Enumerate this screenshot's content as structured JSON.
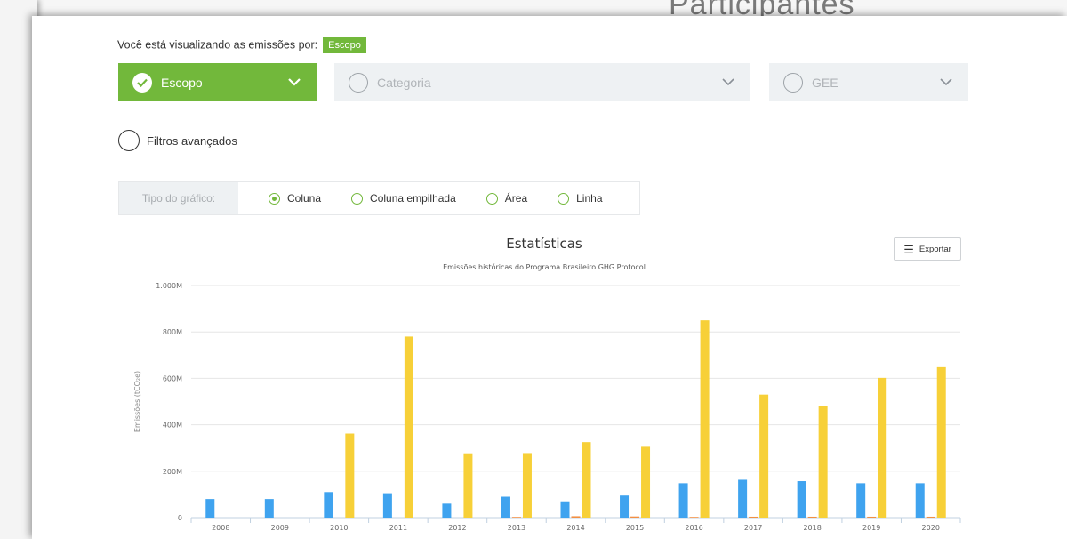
{
  "background_title": "Participantes",
  "viewing": {
    "text": "Você está visualizando as emissões por:",
    "badge": "Escopo"
  },
  "dropdowns": [
    {
      "label": "Escopo",
      "active": true
    },
    {
      "label": "Categoria",
      "active": false
    },
    {
      "label": "GEE",
      "active": false
    }
  ],
  "advanced_filters": "Filtros avançados",
  "chart_type": {
    "label": "Tipo do gráfico:",
    "options": [
      "Coluna",
      "Coluna empilhada",
      "Área",
      "Linha"
    ],
    "selected": "Coluna"
  },
  "export_label": "Exportar",
  "colors": {
    "accent": "#72b83b",
    "series_blue": "#3fa3ef",
    "series_orange": "#f28f43",
    "series_yellow": "#f7d038"
  },
  "chart_data": {
    "type": "bar",
    "title": "Estatísticas",
    "subtitle": "Emissões históricas do Programa Brasileiro GHG Protocol",
    "ylabel": "Emissões (tCO₂e)",
    "xlabel": "",
    "ylim": [
      0,
      1000
    ],
    "yticks": [
      0,
      200,
      400,
      600,
      800,
      1000
    ],
    "ytick_labels": [
      "0",
      "200M",
      "400M",
      "600M",
      "800M",
      "1.000M"
    ],
    "categories": [
      "2008",
      "2009",
      "2010",
      "2011",
      "2012",
      "2013",
      "2014",
      "2015",
      "2016",
      "2017",
      "2018",
      "2019",
      "2020"
    ],
    "series": [
      {
        "color": "#3fa3ef",
        "values": [
          80,
          80,
          110,
          105,
          60,
          90,
          70,
          95,
          148,
          163,
          157,
          148,
          148
        ]
      },
      {
        "color": "#f28f43",
        "values": [
          0,
          0,
          0,
          0,
          0,
          3,
          6,
          5,
          3,
          4,
          4,
          4,
          4
        ]
      },
      {
        "color": "#f7d038",
        "values": [
          0,
          0,
          362,
          780,
          277,
          278,
          325,
          305,
          850,
          530,
          480,
          602,
          648
        ]
      }
    ],
    "grid": true,
    "legend": "none"
  }
}
